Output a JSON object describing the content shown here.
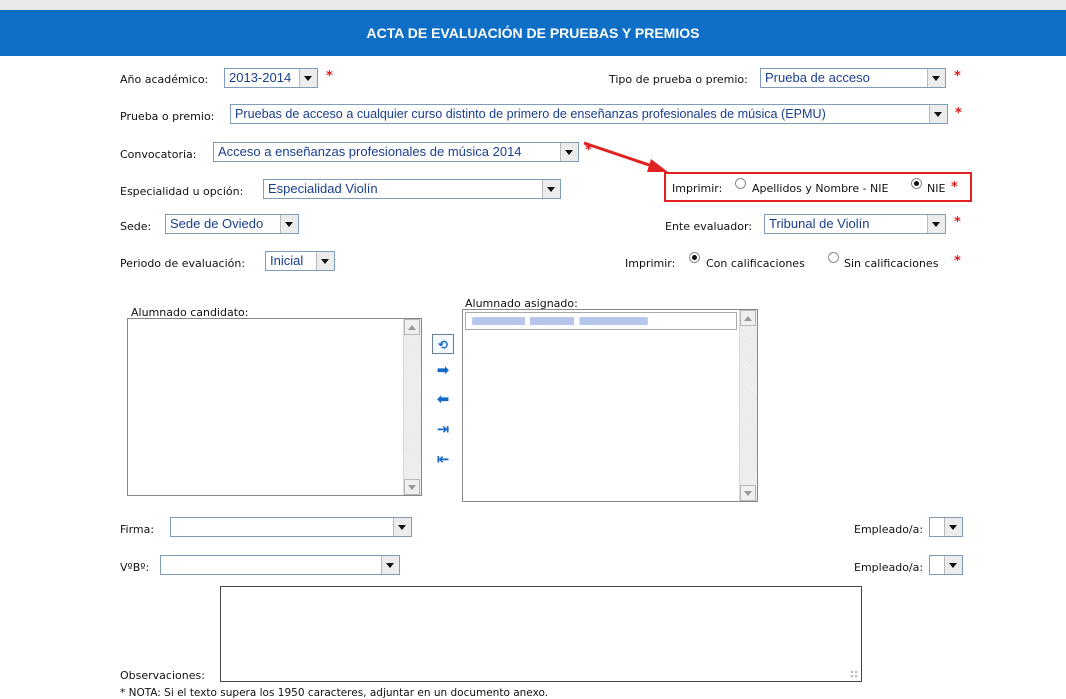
{
  "title": "ACTA DE EVALUACIÓN DE PRUEBAS Y PREMIOS",
  "required_mark": "*",
  "fields": {
    "anio_academico": {
      "label": "Año académico:",
      "value": "2013-2014"
    },
    "tipo_prueba": {
      "label": "Tipo de prueba o premio:",
      "value": "Prueba de acceso"
    },
    "prueba_premio": {
      "label": "Prueba o premio:",
      "value": "Pruebas de acceso a cualquier curso distinto de primero de enseñanzas profesionales de música (EPMU)"
    },
    "convocatoria": {
      "label": "Convocatoria:",
      "value": "Acceso a enseñanzas profesionales de música 2014"
    },
    "especialidad": {
      "label": "Especialidad u opción:",
      "value": "Especialidad Violín"
    },
    "sede": {
      "label": "Sede:",
      "value": "Sede de Oviedo"
    },
    "ente_evaluador": {
      "label": "Ente evaluador:",
      "value": "Tribunal de Violín"
    },
    "periodo": {
      "label": "Periodo de evaluación:",
      "value": "Inicial"
    }
  },
  "imprimir_nombre": {
    "label": "Imprimir:",
    "options": [
      {
        "label": "Apellidos y Nombre - NIE",
        "selected": false
      },
      {
        "label": "NIE",
        "selected": true
      }
    ]
  },
  "imprimir_calificaciones": {
    "label": "Imprimir:",
    "options": [
      {
        "label": "Con calificaciones",
        "selected": true
      },
      {
        "label": "Sin calificaciones",
        "selected": false
      }
    ]
  },
  "lists": {
    "candidato_label": "Alumnado candidato:",
    "asignado_label": "Alumnado asignado:"
  },
  "move_buttons": [
    {
      "name": "refresh-icon",
      "glyph": "⟲"
    },
    {
      "name": "move-right-icon",
      "glyph": "➡"
    },
    {
      "name": "move-left-icon",
      "glyph": "⬅"
    },
    {
      "name": "move-all-right-icon",
      "glyph": "⇥"
    },
    {
      "name": "move-all-left-icon",
      "glyph": "⇤"
    }
  ],
  "firma": {
    "label": "Firma:",
    "value": ""
  },
  "vobo": {
    "label": "VºBº:",
    "value": ""
  },
  "empleado1": {
    "label": "Empleado/a:",
    "value": ""
  },
  "empleado2": {
    "label": "Empleado/a:",
    "value": ""
  },
  "observaciones": {
    "label": "Observaciones:",
    "value": ""
  },
  "nota": "* NOTA: Si el texto supera los 1950 caracteres, adjuntar en un documento anexo.",
  "colors": {
    "header": "#0f6fc6",
    "required": "#e01818",
    "select_text": "#1a3f8f",
    "highlight_box": "#e02222",
    "arrow": "#e02222"
  }
}
